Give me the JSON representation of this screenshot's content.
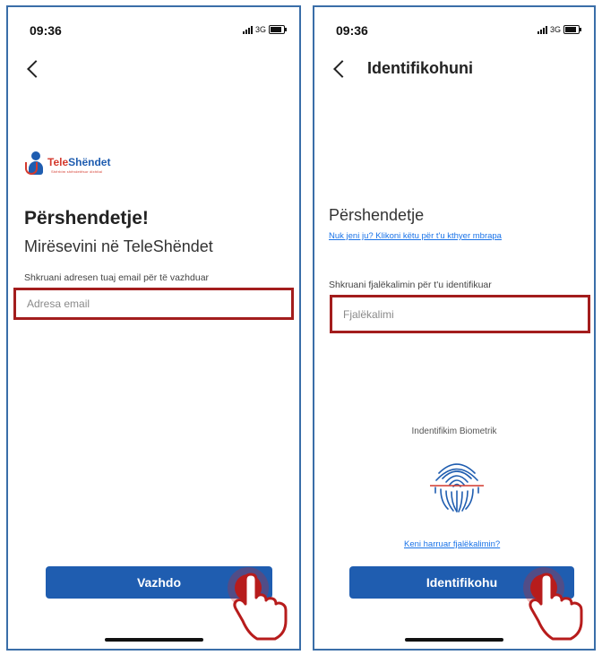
{
  "left_screen": {
    "status": {
      "time": "09:36",
      "network": "3G"
    },
    "logo": {
      "tele": "Tele",
      "shendet": "Shëndet",
      "tagline": "Shërbim shëndetësor dixhital"
    },
    "greeting": "Përshendetje!",
    "welcome": "Mirësevini në TeleShëndet",
    "email_hint": "Shkruani adresen tuaj email për të vazhduar",
    "email_input": {
      "value": "",
      "placeholder": "Adresa email"
    },
    "continue_button": "Vazhdo"
  },
  "right_screen": {
    "status": {
      "time": "09:36",
      "network": "3G"
    },
    "title": "Identifikohuni",
    "greeting": "Përshendetje",
    "not_you_link": "Nuk jeni ju? Klikoni këtu për t'u kthyer mbrapa",
    "password_hint": "Shkruani fjalëkalimin për t'u identifikuar",
    "password_input": {
      "value": "",
      "placeholder": "Fjalëkalimi"
    },
    "biometric_label": "Indentifikim Biometrik",
    "forgot_link": "Keni harruar fjalëkalimin?",
    "login_button": "Identifikohu"
  },
  "colors": {
    "brand_blue": "#1f5db0",
    "highlight_red": "#a31d1d",
    "link_blue": "#1a73e8",
    "frame_blue": "#3a6ea8"
  }
}
